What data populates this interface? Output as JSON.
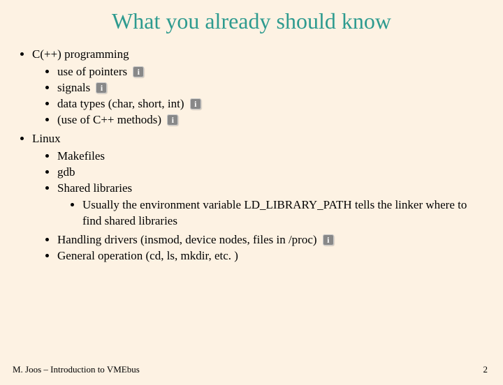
{
  "title": "What you already should know",
  "bullets": {
    "a": "C(++) programming",
    "a1": "use of pointers",
    "a2": "signals",
    "a3": "data types (char, short, int)",
    "a4": "(use of C++ methods)",
    "b": "Linux",
    "b1": "Makefiles",
    "b2": "gdb",
    "b3": "Shared libraries",
    "b3a": "Usually the environment variable LD_LIBRARY_PATH tells the linker where to find shared libraries",
    "b4": "Handling drivers (insmod, device nodes, files in /proc)",
    "b5": "General operation (cd, ls, mkdir, etc. )"
  },
  "footer_left": "M. Joos – Introduction to VMEbus",
  "footer_right": "2"
}
